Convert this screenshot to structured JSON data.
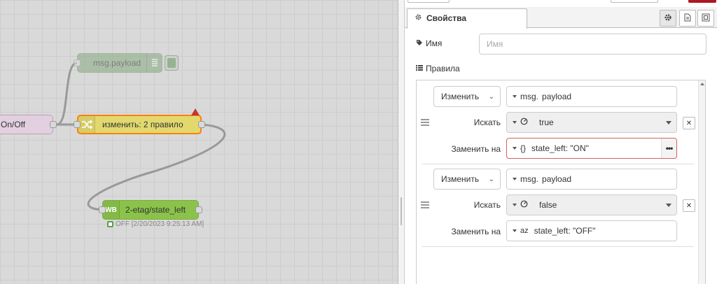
{
  "canvas": {
    "nodes": {
      "onoff": {
        "label": "On/Off"
      },
      "debug": {
        "label": "msg.payload"
      },
      "change": {
        "label": "изменить: 2 правило"
      },
      "wb": {
        "icon_text": "WB",
        "label": "2-etag/state_left",
        "status": "OFF [2/20/2023 9:25:13 AM]"
      }
    }
  },
  "panel": {
    "tab_label": "Свойства",
    "name": {
      "label": "Имя",
      "placeholder": "Имя"
    },
    "rules_label": "Правила",
    "rules": [
      {
        "action": "Изменить",
        "property_prefix": "msg.",
        "property": "payload",
        "search_label": "Искать",
        "search_value": "true",
        "replace_label": "Заменить на",
        "replace_type_glyph": "{}",
        "replace_value": "state_left: \"ON\""
      },
      {
        "action": "Изменить",
        "property_prefix": "msg.",
        "property": "payload",
        "search_label": "Искать",
        "search_value": "false",
        "replace_label": "Заменить на",
        "replace_type_glyph": "az",
        "replace_value": "state_left: \"OFF\""
      }
    ]
  },
  "colors": {
    "debug_node": "#87a980",
    "change_node": "#e2d96e",
    "change_border": "#ff7f0e",
    "wb_node": "#8bc34a",
    "onoff_node": "#e2d0e0",
    "error_border": "#d6615f"
  },
  "icons": {
    "tab": "gear-icon",
    "name": "tag-icon",
    "rules": "list-icon",
    "change_node": "shuffle-icon",
    "debug_list": "list-icon",
    "settings": "gear-icon",
    "description": "file-icon",
    "appearance": "frame-icon"
  }
}
